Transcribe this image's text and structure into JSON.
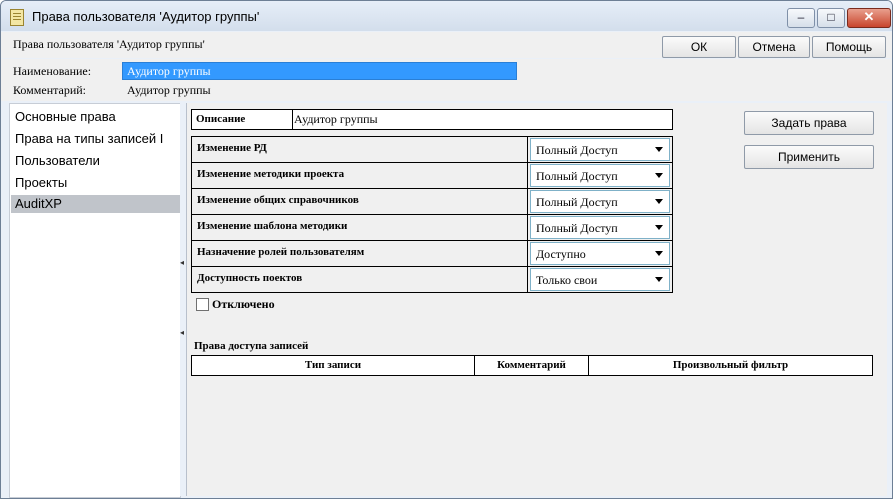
{
  "window": {
    "title": "Права пользователя 'Аудитор группы'"
  },
  "header": {
    "text": "Права пользователя 'Аудитор группы'",
    "ok_label": "ОК",
    "cancel_label": "Отмена",
    "help_label": "Помощь"
  },
  "fields": {
    "name_label": "Наименование:",
    "name_value": "Аудитор группы",
    "comment_label": "Комментарий:",
    "comment_value": "Аудитор группы"
  },
  "nav": {
    "items": [
      {
        "label": "Основные права"
      },
      {
        "label": "Права на типы записей I"
      },
      {
        "label": "Пользователи"
      },
      {
        "label": "Проекты"
      },
      {
        "label": "AuditXP"
      }
    ],
    "selected": "AuditXP"
  },
  "description": {
    "label": "Описание",
    "value": "Аудитор группы"
  },
  "rights": [
    {
      "label": "Изменение РД",
      "value": "Полный Доступ"
    },
    {
      "label": "Изменение методики проекта",
      "value": "Полный Доступ"
    },
    {
      "label": "Изменение общих справочников",
      "value": "Полный Доступ"
    },
    {
      "label": "Изменение шаблона методики",
      "value": "Полный Доступ"
    },
    {
      "label": "Назначение ролей пользователям",
      "value": "Доступно"
    },
    {
      "label": "Доступность поектов",
      "value": "Только свои"
    }
  ],
  "disabled": {
    "label": "Отключено",
    "checked": false
  },
  "records": {
    "title": "Права доступа записей",
    "columns": [
      "Тип записи",
      "Комментарий",
      "Произвольный фильтр"
    ]
  },
  "actions": {
    "set_rights_label": "Задать права",
    "apply_label": "Применить"
  }
}
